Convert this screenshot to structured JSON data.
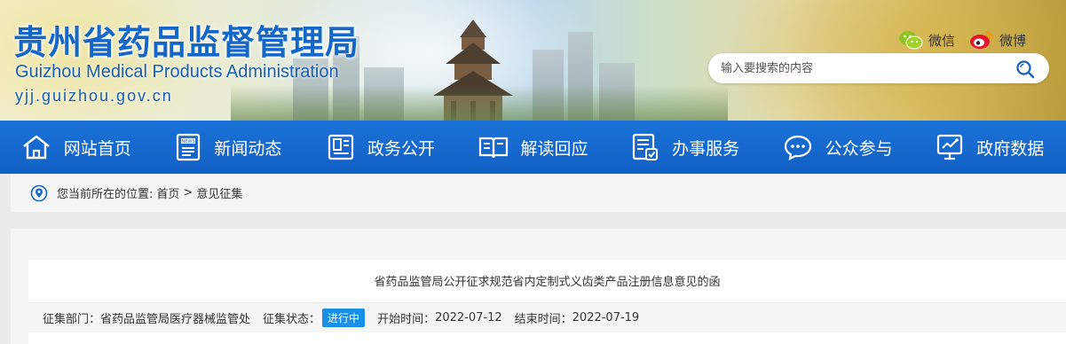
{
  "header": {
    "site_name_cn": "贵州省药品监督管理局",
    "site_name_en": "Guizhou Medical Products Administration",
    "site_url": "yjj.guizhou.gov.cn",
    "social": [
      {
        "label": "微信",
        "icon": "wechat-icon"
      },
      {
        "label": "微博",
        "icon": "weibo-icon"
      }
    ],
    "search": {
      "placeholder": "输入要搜索的内容",
      "value": ""
    }
  },
  "nav": {
    "items": [
      {
        "label": "网站首页",
        "icon": "home-icon"
      },
      {
        "label": "新闻动态",
        "icon": "news-icon"
      },
      {
        "label": "政务公开",
        "icon": "document-icon"
      },
      {
        "label": "解读回应",
        "icon": "book-icon"
      },
      {
        "label": "办事服务",
        "icon": "service-form-icon"
      },
      {
        "label": "公众参与",
        "icon": "chat-icon"
      },
      {
        "label": "政府数据",
        "icon": "data-chart-icon"
      }
    ]
  },
  "breadcrumb": {
    "prefix": "您当前所在的位置:",
    "home": "首页",
    "separator": ">",
    "current": "意见征集"
  },
  "article": {
    "title": "省药品监管局公开征求规范省内定制式义齿类产品注册信息意见的函",
    "dept_label": "征集部门：",
    "dept_value": "省药品监管局医疗器械监管处",
    "status_label": "征集状态：",
    "status_value": "进行中",
    "start_label": "开始时间：",
    "start_value": "2022-07-12",
    "end_label": "结束时间：",
    "end_value": "2022-07-19"
  },
  "colors": {
    "brand_blue": "#1466c8",
    "nav_blue": "#1669d1",
    "status_badge": "#1a8fe8"
  }
}
